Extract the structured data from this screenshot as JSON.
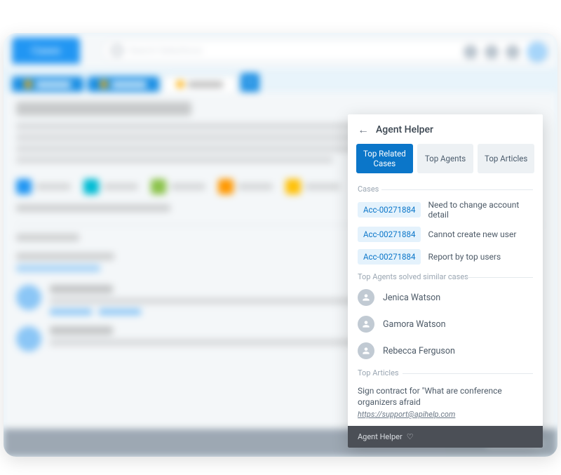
{
  "header": {
    "main_tab": "Cases",
    "search_placeholder": "Search Salesforce"
  },
  "panel": {
    "title": "Agent Helper",
    "tabs": {
      "related": "Top Related Cases",
      "agents": "Top Agents",
      "articles": "Top Articles"
    },
    "sections": {
      "cases_label": "Cases",
      "agents_label": "Top Agents solved similar cases",
      "articles_label": "Top Articles"
    },
    "cases": [
      {
        "id": "Acc-00271884",
        "title": "Need to change account detail"
      },
      {
        "id": "Acc-00271884",
        "title": "Cannot create new user"
      },
      {
        "id": "Acc-00271884",
        "title": "Report by top users"
      }
    ],
    "agents": [
      {
        "name": "Jenica Watson"
      },
      {
        "name": "Gamora Watson"
      },
      {
        "name": "Rebecca Ferguson"
      }
    ],
    "articles": [
      {
        "title": "Sign contract for \"What are conference organizers afraid",
        "link": "https://support@apihelp.com"
      }
    ],
    "footer": "Agent Helper"
  },
  "colors": {
    "primary": "#0b76c9",
    "pill_bg": "#e4f2fc",
    "tab_inactive": "#edf1f4"
  }
}
